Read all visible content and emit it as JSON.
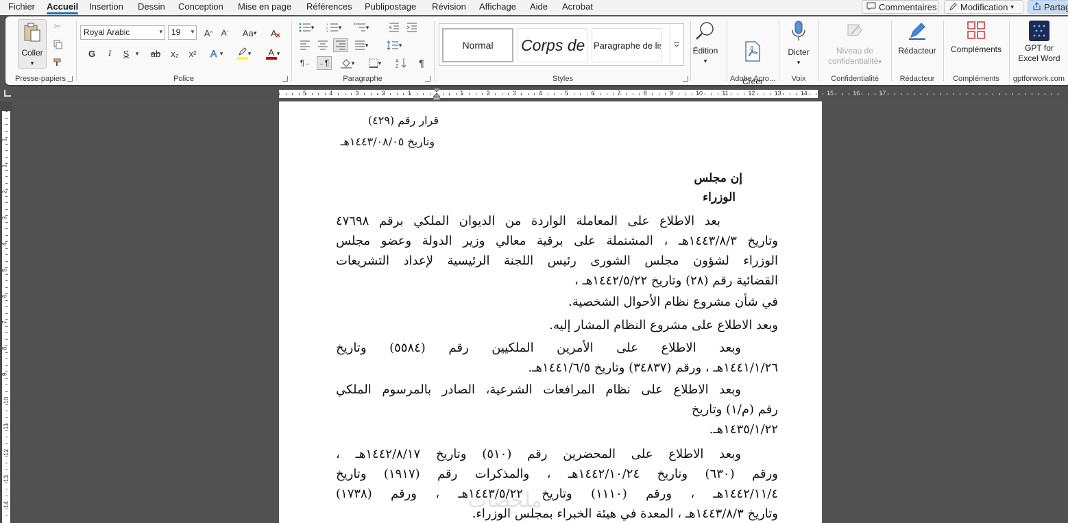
{
  "menubar": {
    "tabs": [
      "Fichier",
      "Accueil",
      "Insertion",
      "Dessin",
      "Conception",
      "Mise en page",
      "Références",
      "Publipostage",
      "Révision",
      "Affichage",
      "Aide",
      "Acrobat"
    ],
    "comments_label": "Commentaires",
    "editing_mode_label": "Modification",
    "share_label": "Partag"
  },
  "ribbon": {
    "clipboard": {
      "paste_label": "Coller",
      "group_label": "Presse-papiers"
    },
    "font": {
      "font_name": "Royal Arabic",
      "font_size": "19",
      "group_label": "Police",
      "bold": "G",
      "italic": "I",
      "underline": "S",
      "strike": "ab",
      "subscript": "x₂",
      "superscript": "x²",
      "highlight_color": "#ffff00",
      "font_color": "#c00000"
    },
    "paragraph": {
      "group_label": "Paragraphe"
    },
    "styles": {
      "group_label": "Styles",
      "items": [
        "Normal",
        "Corps de",
        "Paragraphe de lis"
      ]
    },
    "editing": {
      "label": "Édition"
    },
    "adobe": {
      "create_pdf": "Créer\nun PDF",
      "group_label": "Adobe Acro..."
    },
    "voice": {
      "dictate": "Dicter",
      "group_label": "Voix"
    },
    "sensitivity": {
      "label_line1": "Niveau de",
      "label_line2": "confidentialité",
      "group_label": "Confidentialité"
    },
    "editor": {
      "label": "Rédacteur",
      "group_label": "Rédacteur"
    },
    "addins": {
      "label": "Compléments",
      "group_label": "Compléments"
    },
    "gpt": {
      "label_line1": "GPT for",
      "label_line2": "Excel Word",
      "group_label": "gptforwork.com"
    }
  },
  "ruler": {
    "h_numbers": [
      "5",
      "4",
      "3",
      "2",
      "1",
      "1",
      "2",
      "3",
      "4",
      "5",
      "6",
      "7",
      "8",
      "9",
      "10",
      "11",
      "12",
      "13",
      "14",
      "15",
      "16",
      "17"
    ],
    "v_numbers": [
      "1",
      "1",
      "2",
      "3",
      "4",
      "5",
      "6",
      "7",
      "8",
      "9",
      "10",
      "11",
      "12",
      "13",
      "14"
    ]
  },
  "document": {
    "decision_no": "قرار رقم (٤٢٩)",
    "decision_date": "وتاريخ ١٤٤٣/٠٨/٠٥هـ",
    "council_line1": "إن مجلس",
    "council_line2": "الوزراء",
    "p1": [
      "بعد الاطلاع على المعاملة الواردة من الديوان الملكي برقم ٤٧٦٩٨",
      "وتاريخ ١٤٤٣/٨/٣هـ ، المشتملة على برقية معالي وزير الدولة وعضو مجلس",
      "الوزراء لشؤون مجلس الشورى رئيس اللجنة الرئيسية لإعداد التشريعات",
      "القضائية رقم (٢٨) وتاريخ ١٤٤٢/٥/٢٢هـ ،"
    ],
    "p2": "في شأن مشروع نظام الأحوال الشخصية.",
    "p3": "وبعد الاطلاع على مشروع النظام المشار إليه.",
    "p4": [
      "وبعد الاطلاع على الأمرين الملكيين رقم (٥٥٨٤) وتاريخ",
      "١٤٤١/١/٢٦هـ ، ورقم (٣٤٨٣٧) وتاريخ ١٤٤١/٦/٥هـ."
    ],
    "p5": [
      "وبعد الاطلاع على نظام المرافعات الشرعية، الصادر بالمرسوم الملكي",
      "رقم (م/١) وتاريخ",
      "١٤٣٥/١/٢٢هـ."
    ],
    "p6": [
      "وبعد الاطلاع على المحضرين رقم (٥١٠) وتاريخ ١٤٤٢/٨/١٧هـ ،",
      "ورقم (٦٣٠) وتاريخ ١٤٤٢/١٠/٢٤هـ ، والمذكرات رقم (١٩١٧) وتاريخ",
      "١٤٤٢/١١/٤هـ ، ورقم (١١١٠) وتاريخ ١٤٤٣/٥/٢٢هـ ، ورقم (١٧٣٨)",
      "وتاريخ ١٤٤٣/٨/٣هـ ، المعدة في هيئة الخبراء بمجلس الوزراء."
    ],
    "watermark": "ملخصات"
  }
}
